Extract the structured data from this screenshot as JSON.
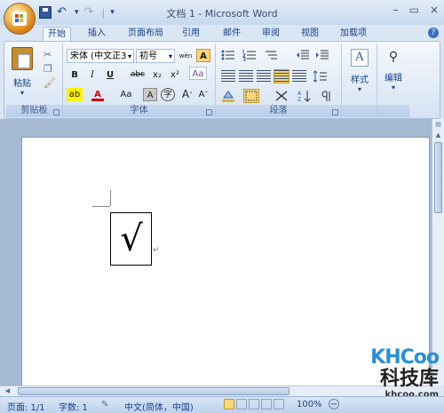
{
  "window": {
    "title": "文档 1 - Microsoft Word",
    "controls": [
      "–",
      "▭",
      "×"
    ]
  },
  "quick_access": {
    "separator": "|",
    "dropdown": "▾"
  },
  "tabs": [
    {
      "label": "开始",
      "active": true
    },
    {
      "label": "插入"
    },
    {
      "label": "页面布局"
    },
    {
      "label": "引用"
    },
    {
      "label": "邮件"
    },
    {
      "label": "审阅"
    },
    {
      "label": "视图"
    },
    {
      "label": "加载项"
    }
  ],
  "help": "?",
  "ribbon": {
    "clipboard": {
      "label": "剪贴板",
      "paste_label": "粘贴"
    },
    "font": {
      "label": "字体",
      "font_name": "宋体 (中文正3",
      "font_size": "初号",
      "bold": "B",
      "italic": "I",
      "underline": "U",
      "strike": "abc",
      "subscript": "x₂",
      "superscript": "x²",
      "clear": "Aa",
      "highlight": "ab",
      "font_color": "A",
      "change_case": "Aa",
      "shade": "A",
      "circle": "字",
      "grow": "A",
      "shrink": "A",
      "wen": "wén",
      "border_char": "A",
      "grow_suffix": "ˆ",
      "shrink_suffix": "ˇ"
    },
    "paragraph": {
      "label": "段落"
    },
    "styles": {
      "label": "样式"
    },
    "editing": {
      "label": "编辑"
    }
  },
  "document": {
    "checkmark": "√",
    "para_mark": "↵"
  },
  "status": {
    "page": "页面: 1/1",
    "words": "字数: 1",
    "language": "中文(简体，中国)",
    "zoom": "100%",
    "zoom_minus": "−"
  },
  "watermark": {
    "logo": "KHCoo",
    "name": "科技库",
    "url": "khcoo.com"
  },
  "colors": {
    "accent": "#15428b",
    "ribbon": "#dbe6f4",
    "highlight": "#f8d77a"
  }
}
